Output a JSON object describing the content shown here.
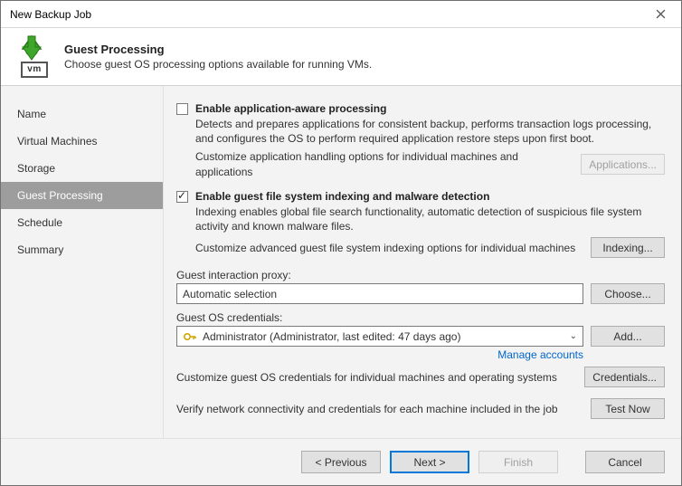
{
  "window": {
    "title": "New Backup Job"
  },
  "header": {
    "title": "Guest Processing",
    "subtitle": "Choose guest OS processing options available for running VMs.",
    "vm_label": "vm"
  },
  "sidebar": {
    "items": [
      {
        "label": "Name"
      },
      {
        "label": "Virtual Machines"
      },
      {
        "label": "Storage"
      },
      {
        "label": "Guest Processing",
        "active": true
      },
      {
        "label": "Schedule"
      },
      {
        "label": "Summary"
      }
    ]
  },
  "options": {
    "app_aware": {
      "checked": false,
      "title": "Enable application-aware processing",
      "desc": "Detects and prepares applications for consistent backup, performs transaction logs processing, and configures the OS to perform required application restore steps upon first boot.",
      "customize_text": "Customize application handling options for individual machines and applications",
      "button": "Applications..."
    },
    "indexing": {
      "checked": true,
      "title": "Enable guest file system indexing and malware detection",
      "desc": "Indexing enables global file search functionality, automatic detection of suspicious file system activity and known malware files.",
      "customize_text": "Customize advanced guest file system indexing options for individual machines",
      "button": "Indexing..."
    }
  },
  "proxy": {
    "label": "Guest interaction proxy:",
    "value": "Automatic selection",
    "button": "Choose..."
  },
  "credentials": {
    "label": "Guest OS credentials:",
    "value": "Administrator (Administrator, last edited: 47 days ago)",
    "add_button": "Add...",
    "manage_link": "Manage accounts",
    "customize_text": "Customize guest OS credentials for individual machines and operating systems",
    "credentials_button": "Credentials...",
    "verify_text": "Verify network connectivity and credentials for each machine included in the job",
    "test_button": "Test Now"
  },
  "footer": {
    "previous": "< Previous",
    "next": "Next >",
    "finish": "Finish",
    "cancel": "Cancel"
  }
}
